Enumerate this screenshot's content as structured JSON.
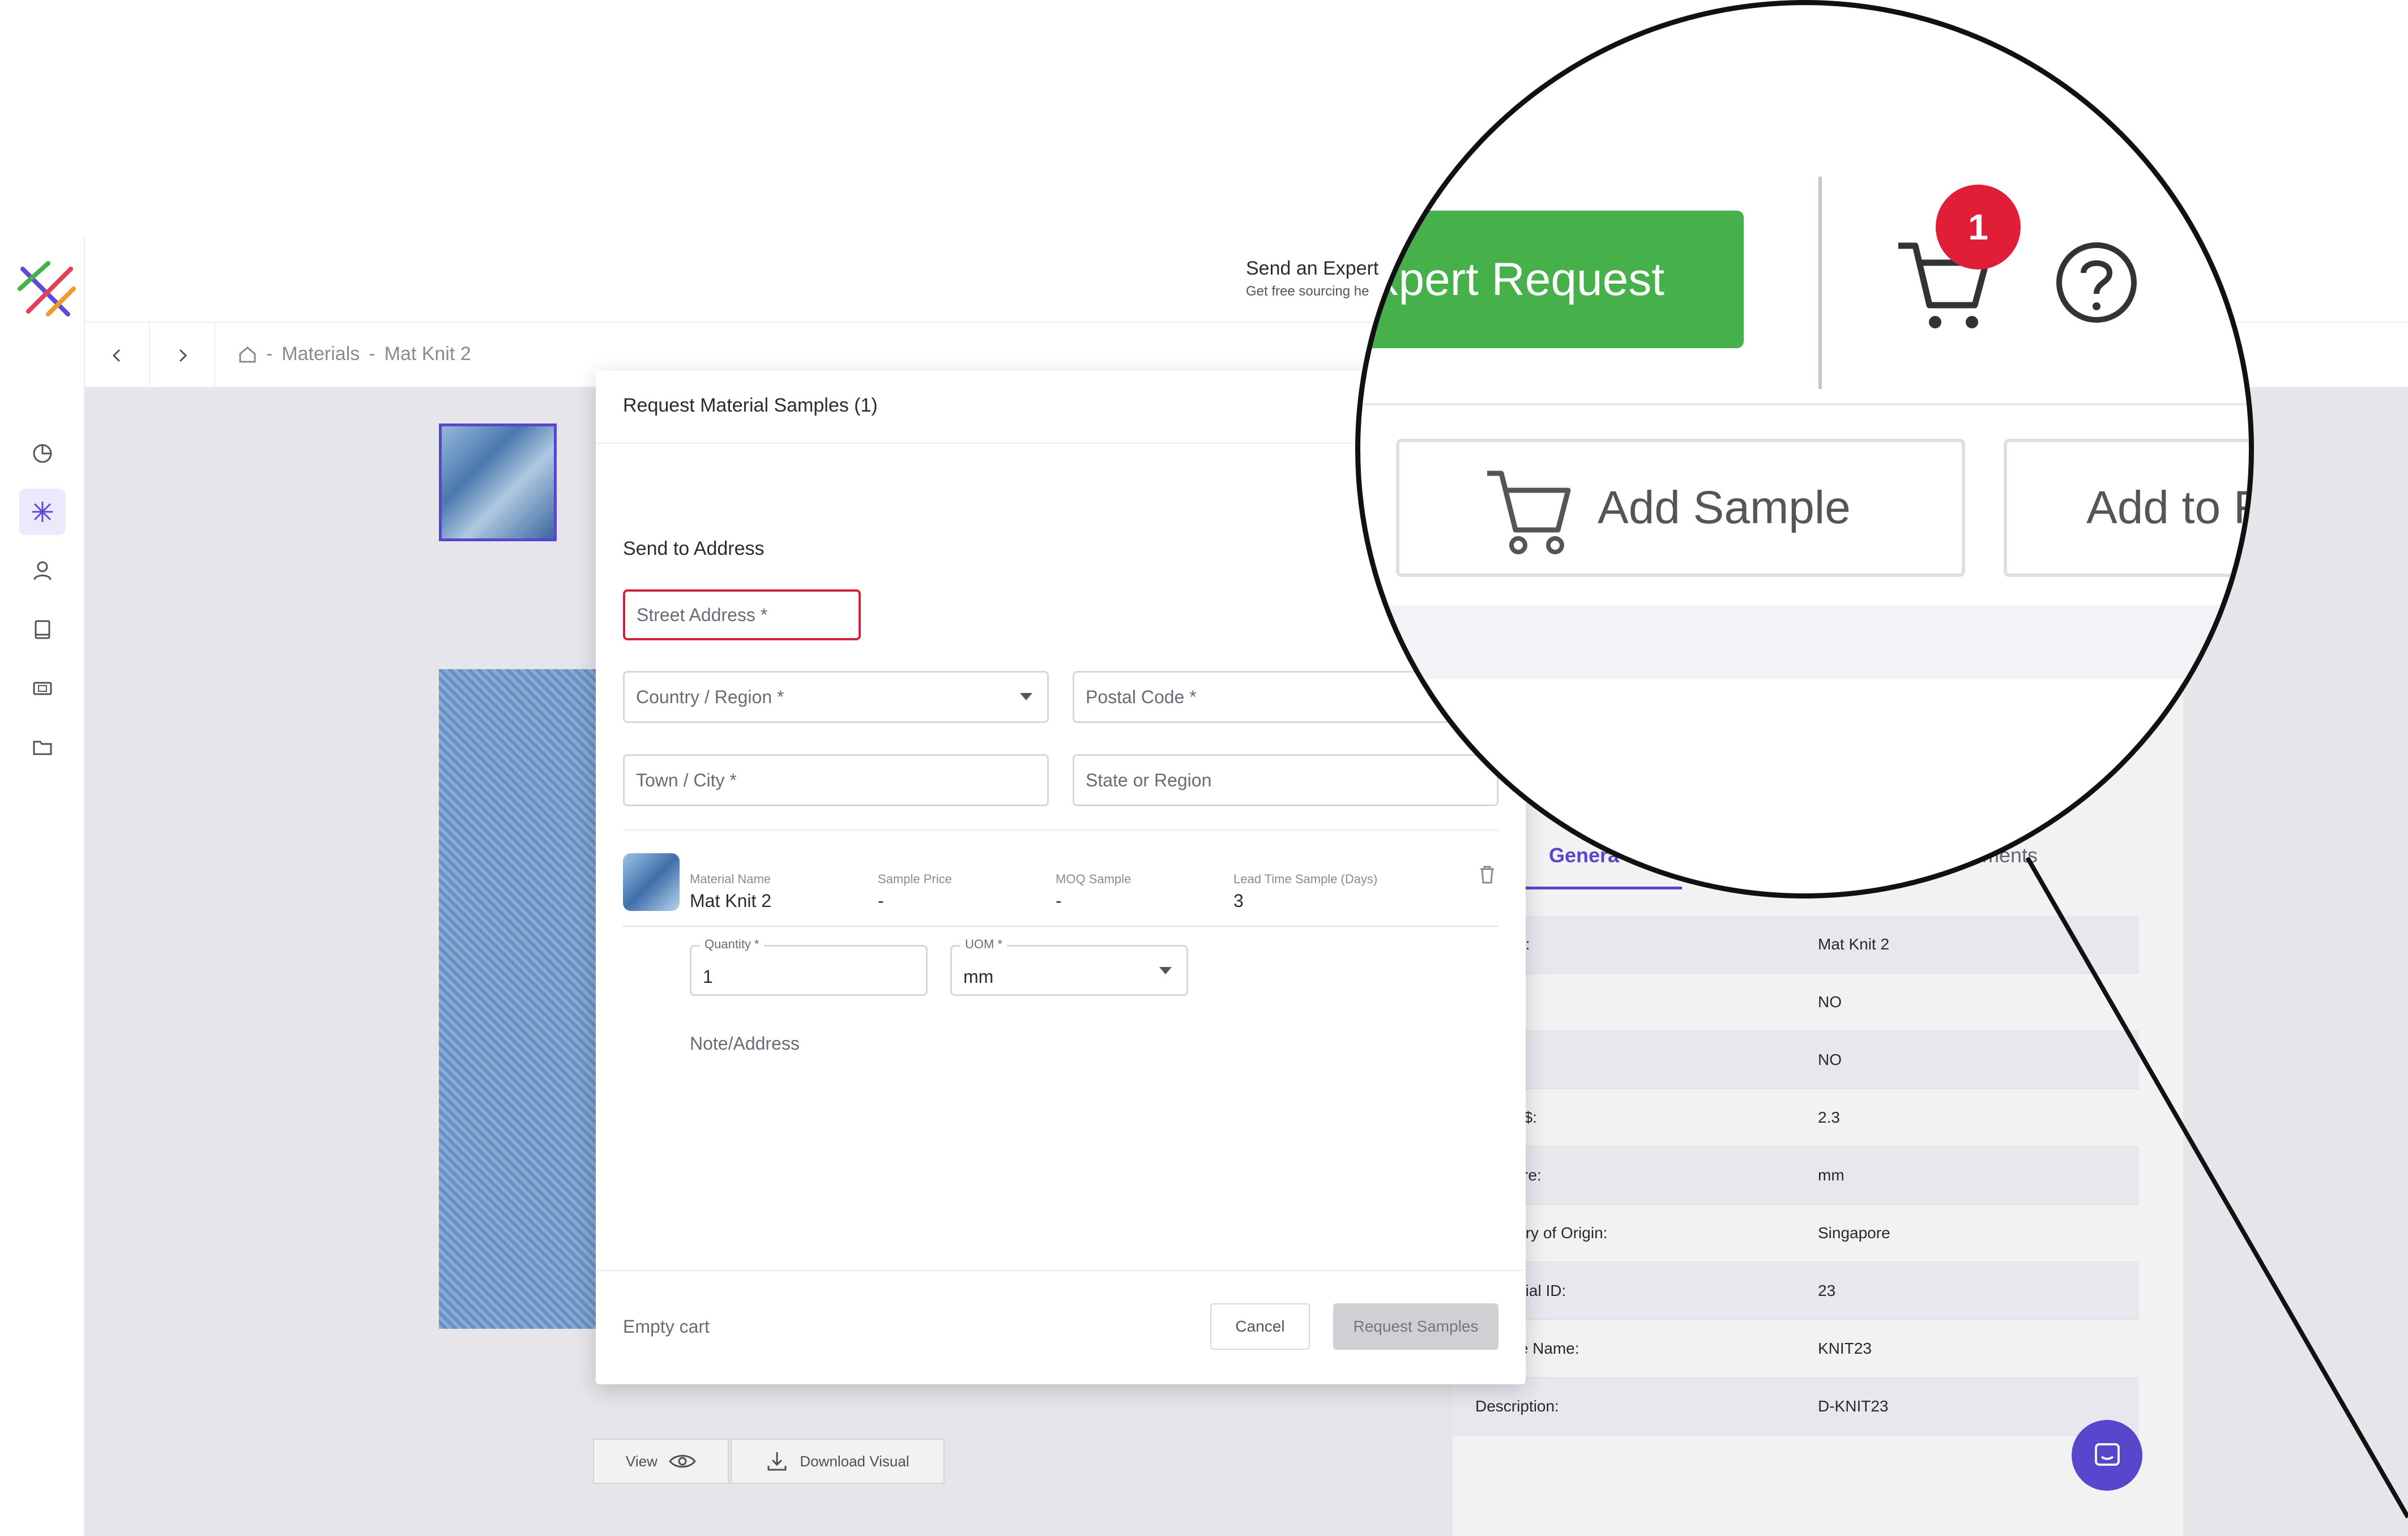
{
  "header": {
    "expert_title": "Send an Expert",
    "expert_subtitle": "Get free sourcing he"
  },
  "breadcrumb": {
    "item1": "Materials",
    "separator": "-",
    "item2": "Mat Knit 2"
  },
  "modal": {
    "title": "Request Material Samples (1)",
    "section_title": "Send to Address",
    "street_placeholder": "Street Address *",
    "country_placeholder": "Country / Region *",
    "postal_placeholder": "Postal Code *",
    "town_placeholder": "Town / City *",
    "state_placeholder": "State or Region",
    "item": {
      "name_label": "Material Name",
      "name": "Mat Knit 2",
      "price_label": "Sample Price",
      "price": "-",
      "moq_label": "MOQ Sample",
      "moq": "-",
      "lead_label": "Lead Time Sample (Days)",
      "lead": "3"
    },
    "quantity_label": "Quantity *",
    "quantity_value": "1",
    "uom_label": "UOM *",
    "uom_value": "mm",
    "note_label": "Note/Address",
    "empty_cart": "Empty cart",
    "cancel": "Cancel",
    "request": "Request Samples"
  },
  "bottom_actions": {
    "view": "View",
    "download": "Download Visual"
  },
  "details": {
    "tab_general": "Genera",
    "tab_comments": "ments",
    "rows": [
      {
        "label": "l Name:",
        "value": "Mat Knit 2"
      },
      {
        "label": "inued:",
        "value": "NO"
      },
      {
        "label": "Quote:",
        "value": "NO"
      },
      {
        "label": "l Price $:",
        "value": "2.3"
      },
      {
        "label": "Measure:",
        "value": "mm"
      },
      {
        "label": "l Country of Origin:",
        "value": "Singapore"
      },
      {
        "label": "r Material ID:",
        "value": "23"
      },
      {
        "label": "r Article Name:",
        "value": "KNIT23"
      },
      {
        "label": "Description:",
        "value": "D-KNIT23"
      }
    ]
  },
  "zoom": {
    "request_button": "xpert Request",
    "cart_badge": "1",
    "add_sample": "Add Sample",
    "add_to": "Add to F"
  },
  "colors": {
    "accent": "#5b4bd8",
    "green": "#46b04a",
    "badge_red": "#e01e37",
    "error": "#d0223a"
  }
}
